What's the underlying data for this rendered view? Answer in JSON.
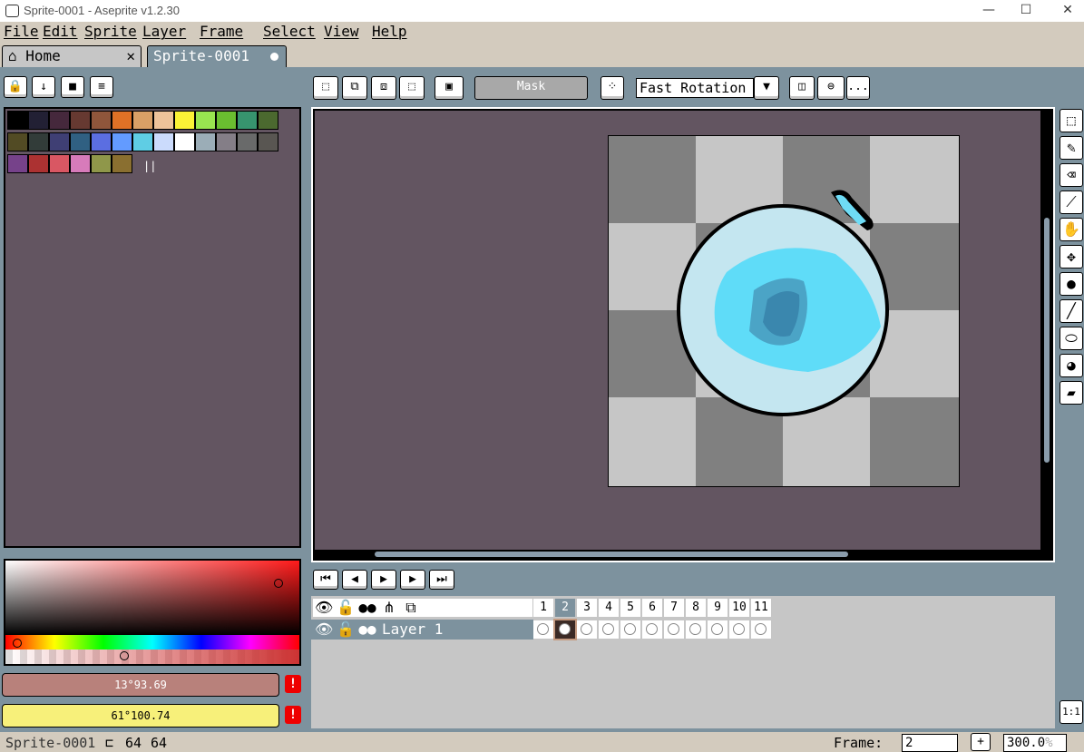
{
  "window": {
    "title": "Sprite-0001 - Aseprite v1.2.30",
    "minimize_glyph": "—",
    "maximize_glyph": "☐",
    "close_glyph": "✕"
  },
  "menu": [
    "File",
    "Edit",
    "Sprite",
    "Layer",
    "Frame",
    "Select",
    "View",
    "Help"
  ],
  "tabs": [
    {
      "label": "Home",
      "icon": "home-icon",
      "close": "✕"
    },
    {
      "label": "Sprite-0001",
      "icon": "modified-dot-icon"
    }
  ],
  "context_bar": {
    "mask_label": "Mask",
    "rotation_algorithm": "Fast Rotation",
    "more_label": "..."
  },
  "palette": {
    "colors": [
      "#000000",
      "#222034",
      "#45283c",
      "#663931",
      "#8f563b",
      "#df7126",
      "#d9a066",
      "#eec39a",
      "#fbf236",
      "#99e550",
      "#6abe30",
      "#37946e",
      "#4b692f",
      "#524b24",
      "#323c39",
      "#3f3f74",
      "#306082",
      "#5b6ee1",
      "#639bff",
      "#5fcde4",
      "#cbdbfc",
      "#ffffff",
      "#9badb7",
      "#847e87",
      "#696a6a",
      "#595652",
      "#76428a",
      "#ac3232",
      "#d95763",
      "#d77bba",
      "#8f974a",
      "#8a6f30"
    ]
  },
  "colorbar": {
    "fg_color_text": "13°93.69",
    "bg_color_text": "61°100.74",
    "fg_color": "#b8817b",
    "bg_color": "#f7f07a",
    "warning_glyph": "!"
  },
  "timeline": {
    "frames": [
      "1",
      "2",
      "3",
      "4",
      "5",
      "6",
      "7",
      "8",
      "9",
      "10",
      "11"
    ],
    "active_frame_index": 1,
    "layers": [
      {
        "name": "Layer 1"
      }
    ]
  },
  "statusbar": {
    "sprite_name": "Sprite-0001",
    "width": "64",
    "height": "64",
    "frame_label": "Frame:",
    "frame_value": "2",
    "add_frame_label": "+",
    "zoom": "300.0",
    "zoom_suffix": "%"
  },
  "toolbar": {
    "one_to_one_label": "1:1"
  },
  "colors": {
    "workspace": "#7d929e",
    "canvas_bg": "#635561",
    "menu_bg": "#d3cbbe"
  }
}
